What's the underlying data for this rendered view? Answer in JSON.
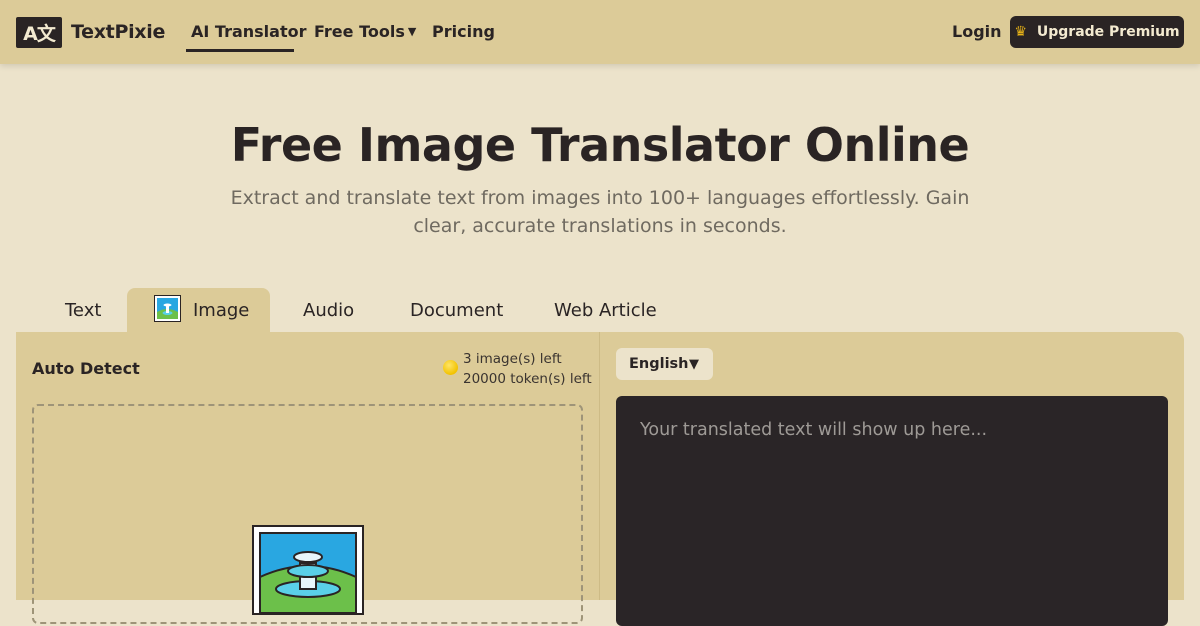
{
  "header": {
    "logo_mark": "A文",
    "logo_text": "TextPixie",
    "nav": {
      "ai_translator": "AI Translator",
      "free_tools": "Free Tools",
      "pricing": "Pricing"
    },
    "login": "Login",
    "upgrade": "Upgrade Premium",
    "upgrade_icon": "crown-icon"
  },
  "hero": {
    "title": "Free Image Translator Online",
    "subtitle": "Extract and translate text from images into 100+ languages effortlessly. Gain clear, accurate translations in seconds."
  },
  "tabs": {
    "text": "Text",
    "image": "Image",
    "audio": "Audio",
    "document": "Document",
    "web_article": "Web Article",
    "active": "Image"
  },
  "source": {
    "language": "Auto Detect",
    "images_left": "3 image(s) left",
    "tokens_left": "20000 token(s) left"
  },
  "target": {
    "language": "English",
    "placeholder": "Your translated text will show up here..."
  },
  "colors": {
    "header_bg": "#dccb98",
    "page_bg": "#ece3cb",
    "dark": "#2a2424",
    "coin": "#f2c200"
  }
}
